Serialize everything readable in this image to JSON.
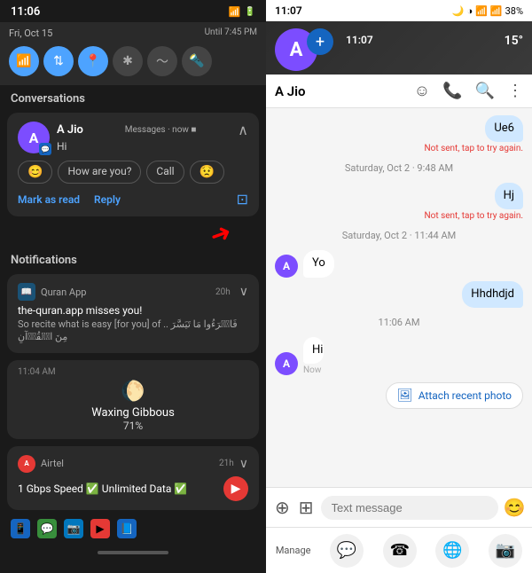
{
  "left": {
    "statusBar": {
      "time": "11:06",
      "signalText": "📶🔋"
    },
    "quickSettings": {
      "date": "Fri, Oct 15",
      "until": "Until 7:45 PM",
      "icons": [
        {
          "name": "wifi",
          "symbol": "📶",
          "active": true
        },
        {
          "name": "data-transfer",
          "symbol": "⇅",
          "active": true
        },
        {
          "name": "location",
          "symbol": "📍",
          "active": true
        },
        {
          "name": "bluetooth",
          "symbol": "✱",
          "active": false
        },
        {
          "name": "nfc",
          "symbol": "〜",
          "active": false
        },
        {
          "name": "flashlight",
          "symbol": "🔦",
          "active": false
        }
      ]
    },
    "conversationsLabel": "Conversations",
    "conversation": {
      "avatarLetter": "A",
      "name": "A Jio",
      "source": "Messages",
      "time": "now",
      "message": "Hi",
      "replies": [
        "😊",
        "How are you?",
        "Call",
        "😟"
      ],
      "markAsRead": "Mark as read",
      "reply": "Reply"
    },
    "arrowNote": "↑",
    "notificationsLabel": "Notifications",
    "quranNotif": {
      "app": "Quran App",
      "time": "20h",
      "title": "the-quran.app misses you!",
      "body": "So recite what is easy [for you] of .. فَاقۡرَءُوا مَا تَيَسَّرَ مِنَ الۡقُرۡآنِ"
    },
    "moonCard": {
      "time": "11:04 AM",
      "phase": "Waxing Gibbous",
      "percent": "71%"
    },
    "airtelNotif": {
      "app": "Airtel",
      "time": "21h",
      "text": "1 Gbps Speed ✅ Unlimited Data ✅"
    },
    "bottomApps": [
      "📱",
      "💬",
      "📷",
      "▶",
      "📘"
    ]
  },
  "right": {
    "statusBar": {
      "time": "11:07",
      "icons": "🌙 ◑ 📶 🔋38%",
      "battery": "38%"
    },
    "floatingAvatar": "A",
    "timeOverlay": "11:07",
    "tempOverlay": "15°",
    "toolbar": {
      "contactName": "A Jio",
      "icons": [
        "smiley",
        "phone",
        "search",
        "more"
      ]
    },
    "messages": [
      {
        "type": "sent",
        "text": "Ue6",
        "error": "Not sent, tap to try again."
      },
      {
        "type": "timestamp",
        "text": "Saturday, Oct 2 · 9:48 AM"
      },
      {
        "type": "sent",
        "text": "Hj",
        "error": "Not sent, tap to try again."
      },
      {
        "type": "timestamp",
        "text": "Saturday, Oct 2 · 11:44 AM"
      },
      {
        "type": "received",
        "text": "Yo"
      },
      {
        "type": "sent",
        "text": "Hhdhdjd"
      },
      {
        "type": "timestamp",
        "text": "11:06 AM"
      },
      {
        "type": "received",
        "text": "Hi",
        "subtext": "Now"
      }
    ],
    "attachSuggestion": "Attach recent photo",
    "inputBar": {
      "placeholder": "Text message"
    },
    "bottomNav": {
      "manageLabel": "Manage"
    }
  }
}
